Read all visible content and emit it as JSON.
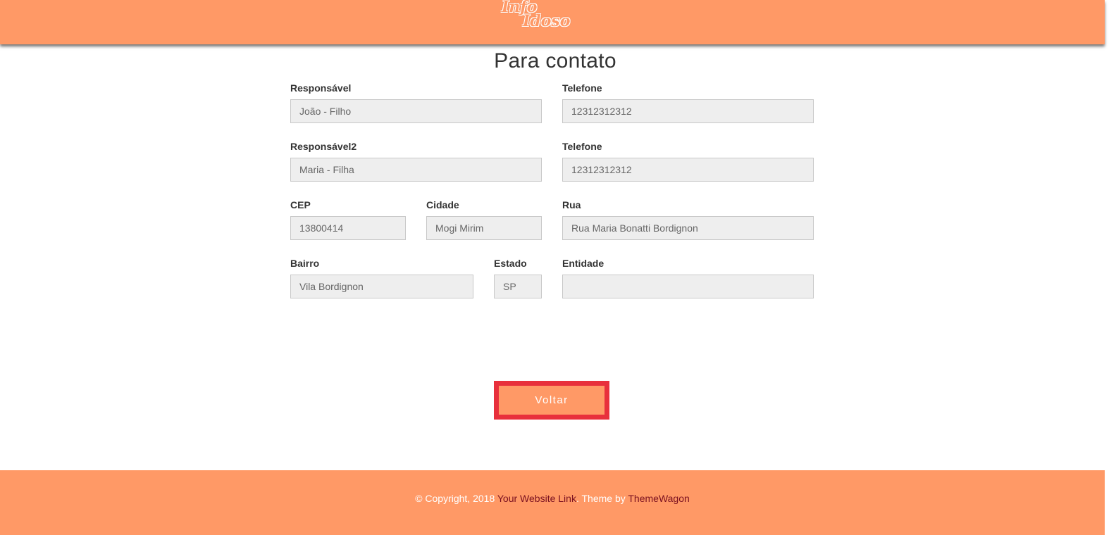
{
  "header": {
    "logo_line1": "Info",
    "logo_line2": "Idoso"
  },
  "page": {
    "title": "Para contato"
  },
  "form": {
    "responsavel": {
      "label": "Responsável",
      "value": "João - Filho"
    },
    "telefone1": {
      "label": "Telefone",
      "value": "12312312312"
    },
    "responsavel2": {
      "label": "Responsável2",
      "value": "Maria - Filha"
    },
    "telefone2": {
      "label": "Telefone",
      "value": "12312312312"
    },
    "cep": {
      "label": "CEP",
      "value": "13800414"
    },
    "cidade": {
      "label": "Cidade",
      "value": "Mogi Mirim"
    },
    "rua": {
      "label": "Rua",
      "value": "Rua Maria Bonatti Bordignon"
    },
    "bairro": {
      "label": "Bairro",
      "value": "Vila Bordignon"
    },
    "estado": {
      "label": "Estado",
      "value": "SP"
    },
    "entidade": {
      "label": "Entidade",
      "value": ""
    }
  },
  "actions": {
    "back_label": "Voltar"
  },
  "footer": {
    "copyright": "© Copyright, 2018",
    "website_link": "Your Website Link",
    "theme_by": ". Theme by",
    "themewagon_link": "ThemeWagon"
  },
  "colors": {
    "brand_orange": "#ff9966",
    "highlight_red": "#e8303c",
    "footer_link": "#7a1020"
  }
}
